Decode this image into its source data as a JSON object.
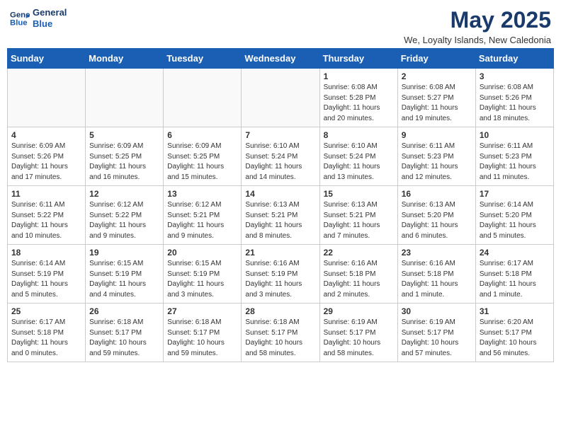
{
  "header": {
    "logo_line1": "General",
    "logo_line2": "Blue",
    "title": "May 2025",
    "subtitle": "We, Loyalty Islands, New Caledonia"
  },
  "columns": [
    "Sunday",
    "Monday",
    "Tuesday",
    "Wednesday",
    "Thursday",
    "Friday",
    "Saturday"
  ],
  "weeks": [
    [
      {
        "day": "",
        "info": ""
      },
      {
        "day": "",
        "info": ""
      },
      {
        "day": "",
        "info": ""
      },
      {
        "day": "",
        "info": ""
      },
      {
        "day": "1",
        "info": "Sunrise: 6:08 AM\nSunset: 5:28 PM\nDaylight: 11 hours\nand 20 minutes."
      },
      {
        "day": "2",
        "info": "Sunrise: 6:08 AM\nSunset: 5:27 PM\nDaylight: 11 hours\nand 19 minutes."
      },
      {
        "day": "3",
        "info": "Sunrise: 6:08 AM\nSunset: 5:26 PM\nDaylight: 11 hours\nand 18 minutes."
      }
    ],
    [
      {
        "day": "4",
        "info": "Sunrise: 6:09 AM\nSunset: 5:26 PM\nDaylight: 11 hours\nand 17 minutes."
      },
      {
        "day": "5",
        "info": "Sunrise: 6:09 AM\nSunset: 5:25 PM\nDaylight: 11 hours\nand 16 minutes."
      },
      {
        "day": "6",
        "info": "Sunrise: 6:09 AM\nSunset: 5:25 PM\nDaylight: 11 hours\nand 15 minutes."
      },
      {
        "day": "7",
        "info": "Sunrise: 6:10 AM\nSunset: 5:24 PM\nDaylight: 11 hours\nand 14 minutes."
      },
      {
        "day": "8",
        "info": "Sunrise: 6:10 AM\nSunset: 5:24 PM\nDaylight: 11 hours\nand 13 minutes."
      },
      {
        "day": "9",
        "info": "Sunrise: 6:11 AM\nSunset: 5:23 PM\nDaylight: 11 hours\nand 12 minutes."
      },
      {
        "day": "10",
        "info": "Sunrise: 6:11 AM\nSunset: 5:23 PM\nDaylight: 11 hours\nand 11 minutes."
      }
    ],
    [
      {
        "day": "11",
        "info": "Sunrise: 6:11 AM\nSunset: 5:22 PM\nDaylight: 11 hours\nand 10 minutes."
      },
      {
        "day": "12",
        "info": "Sunrise: 6:12 AM\nSunset: 5:22 PM\nDaylight: 11 hours\nand 9 minutes."
      },
      {
        "day": "13",
        "info": "Sunrise: 6:12 AM\nSunset: 5:21 PM\nDaylight: 11 hours\nand 9 minutes."
      },
      {
        "day": "14",
        "info": "Sunrise: 6:13 AM\nSunset: 5:21 PM\nDaylight: 11 hours\nand 8 minutes."
      },
      {
        "day": "15",
        "info": "Sunrise: 6:13 AM\nSunset: 5:21 PM\nDaylight: 11 hours\nand 7 minutes."
      },
      {
        "day": "16",
        "info": "Sunrise: 6:13 AM\nSunset: 5:20 PM\nDaylight: 11 hours\nand 6 minutes."
      },
      {
        "day": "17",
        "info": "Sunrise: 6:14 AM\nSunset: 5:20 PM\nDaylight: 11 hours\nand 5 minutes."
      }
    ],
    [
      {
        "day": "18",
        "info": "Sunrise: 6:14 AM\nSunset: 5:19 PM\nDaylight: 11 hours\nand 5 minutes."
      },
      {
        "day": "19",
        "info": "Sunrise: 6:15 AM\nSunset: 5:19 PM\nDaylight: 11 hours\nand 4 minutes."
      },
      {
        "day": "20",
        "info": "Sunrise: 6:15 AM\nSunset: 5:19 PM\nDaylight: 11 hours\nand 3 minutes."
      },
      {
        "day": "21",
        "info": "Sunrise: 6:16 AM\nSunset: 5:19 PM\nDaylight: 11 hours\nand 3 minutes."
      },
      {
        "day": "22",
        "info": "Sunrise: 6:16 AM\nSunset: 5:18 PM\nDaylight: 11 hours\nand 2 minutes."
      },
      {
        "day": "23",
        "info": "Sunrise: 6:16 AM\nSunset: 5:18 PM\nDaylight: 11 hours\nand 1 minute."
      },
      {
        "day": "24",
        "info": "Sunrise: 6:17 AM\nSunset: 5:18 PM\nDaylight: 11 hours\nand 1 minute."
      }
    ],
    [
      {
        "day": "25",
        "info": "Sunrise: 6:17 AM\nSunset: 5:18 PM\nDaylight: 11 hours\nand 0 minutes."
      },
      {
        "day": "26",
        "info": "Sunrise: 6:18 AM\nSunset: 5:17 PM\nDaylight: 10 hours\nand 59 minutes."
      },
      {
        "day": "27",
        "info": "Sunrise: 6:18 AM\nSunset: 5:17 PM\nDaylight: 10 hours\nand 59 minutes."
      },
      {
        "day": "28",
        "info": "Sunrise: 6:18 AM\nSunset: 5:17 PM\nDaylight: 10 hours\nand 58 minutes."
      },
      {
        "day": "29",
        "info": "Sunrise: 6:19 AM\nSunset: 5:17 PM\nDaylight: 10 hours\nand 58 minutes."
      },
      {
        "day": "30",
        "info": "Sunrise: 6:19 AM\nSunset: 5:17 PM\nDaylight: 10 hours\nand 57 minutes."
      },
      {
        "day": "31",
        "info": "Sunrise: 6:20 AM\nSunset: 5:17 PM\nDaylight: 10 hours\nand 56 minutes."
      }
    ]
  ]
}
